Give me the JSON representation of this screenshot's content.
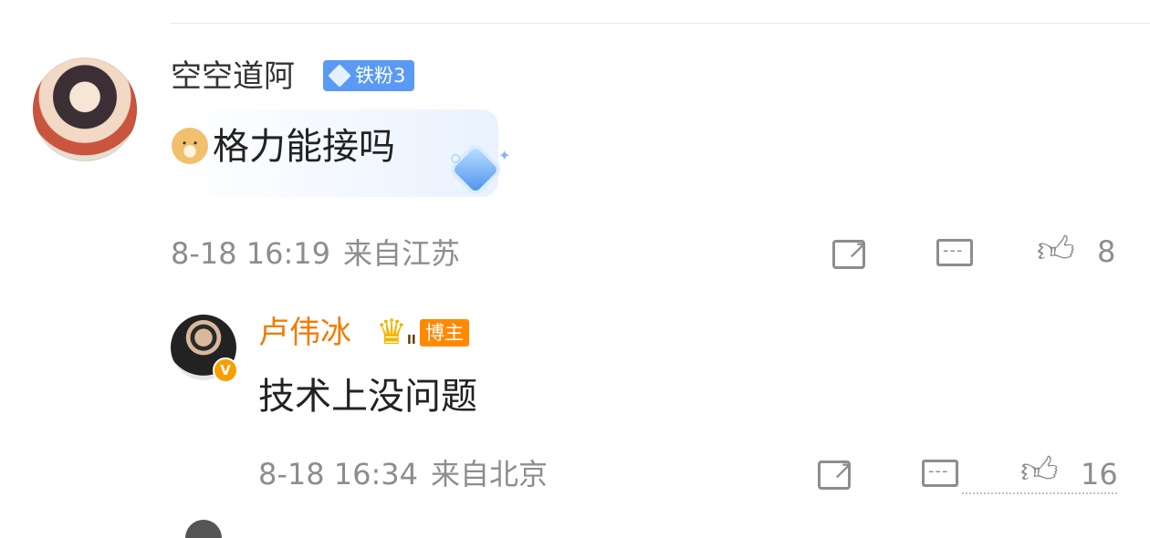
{
  "comment": {
    "username": "空空道阿",
    "fan_badge": "铁粉3",
    "text": "格力能接吗",
    "timestamp": "8-18 16:19",
    "location": "来自江苏",
    "likes": "8"
  },
  "reply": {
    "username": "卢伟冰",
    "role_badge": "博主",
    "crown_level": "II",
    "verified_mark": "V",
    "text": "技术上没问题",
    "timestamp": "8-18 16:34",
    "location": "来自北京",
    "likes": "16"
  },
  "icons": {
    "share": "share-icon",
    "comment": "comment-icon",
    "like": "thumbs-up-icon"
  },
  "colors": {
    "reply_name": "#f07c00",
    "fan_badge_bg": "#5a9af5",
    "meta_text": "#8d8d8d"
  }
}
